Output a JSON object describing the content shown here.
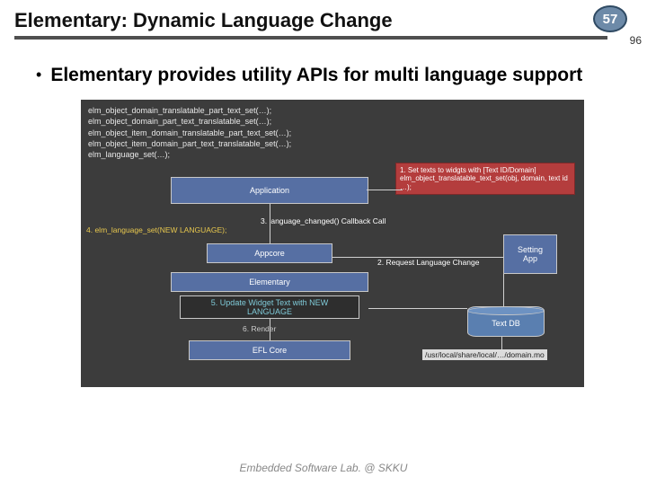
{
  "header": {
    "title": "Elementary: Dynamic Language Change",
    "slide_number": "57",
    "sub_page": "96"
  },
  "bullet": "Elementary provides utility APIs for multi language support",
  "diagram": {
    "api_lines": [
      "elm_object_domain_translatable_part_text_set(…);",
      "elm_object_domain_part_text_translatable_set(…);",
      "elm_object_item_domain_translatable_part_text_set(…);",
      "elm_object_item_domain_part_text_translatable_set(…);",
      "elm_language_set(…);"
    ],
    "boxes": {
      "application": "Application",
      "appcore": "Appcore",
      "elementary": "Elementary",
      "update": "5. Update Widget Text with NEW\nLANGUAGE",
      "render": "6. Render",
      "efl_core": "EFL Core",
      "setting_app": "Setting\nApp",
      "text_db": "Text DB"
    },
    "notes": {
      "step1_a": "1. Set texts to widgts with [Text ID/Domain]",
      "step1_b": "elm_object_translatable_text_set(obj, domain, text id …);",
      "step2": "2. Request Language Change",
      "step3": "3. language_changed() Callback  Call",
      "step4": "4. elm_language_set(NEW LANGUAGE);"
    },
    "path": "/usr/local/share/local/…/domain.mo"
  },
  "footer": "Embedded Software Lab. @ SKKU"
}
